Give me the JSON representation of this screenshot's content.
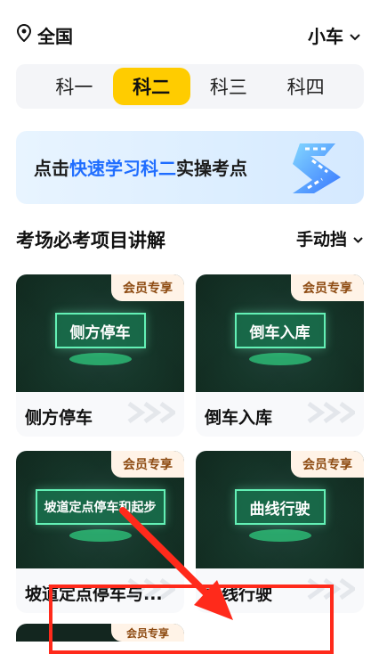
{
  "header": {
    "location": "全国",
    "vehicle": "小车"
  },
  "subjects": [
    {
      "label": "科一",
      "active": false
    },
    {
      "label": "科二",
      "active": true
    },
    {
      "label": "科三",
      "active": false
    },
    {
      "label": "科四",
      "active": false
    }
  ],
  "banner": {
    "prefix": "点击",
    "highlight": "快速学习科二",
    "suffix": "实操考点"
  },
  "section": {
    "title": "考场必考项目讲解",
    "transmission": "手动挡"
  },
  "cards": [
    {
      "badge": "会员专享",
      "thumb": "侧方停车",
      "label": "侧方停车"
    },
    {
      "badge": "会员专享",
      "thumb": "倒车入库",
      "label": "倒车入库"
    },
    {
      "badge": "会员专享",
      "thumb": "坡道定点停车和起步",
      "label": "坡道定点停车与..."
    },
    {
      "badge": "会员专享",
      "thumb": "曲线行驶",
      "label": "曲线行驶"
    }
  ],
  "next_card": {
    "badge": "会员专享"
  },
  "colors": {
    "active_tab": "#ffcc00",
    "banner_highlight": "#1f6dff",
    "badge_bg": "#fff3e7",
    "badge_text": "#8d4a11",
    "annotation": "#ff2a1b"
  }
}
